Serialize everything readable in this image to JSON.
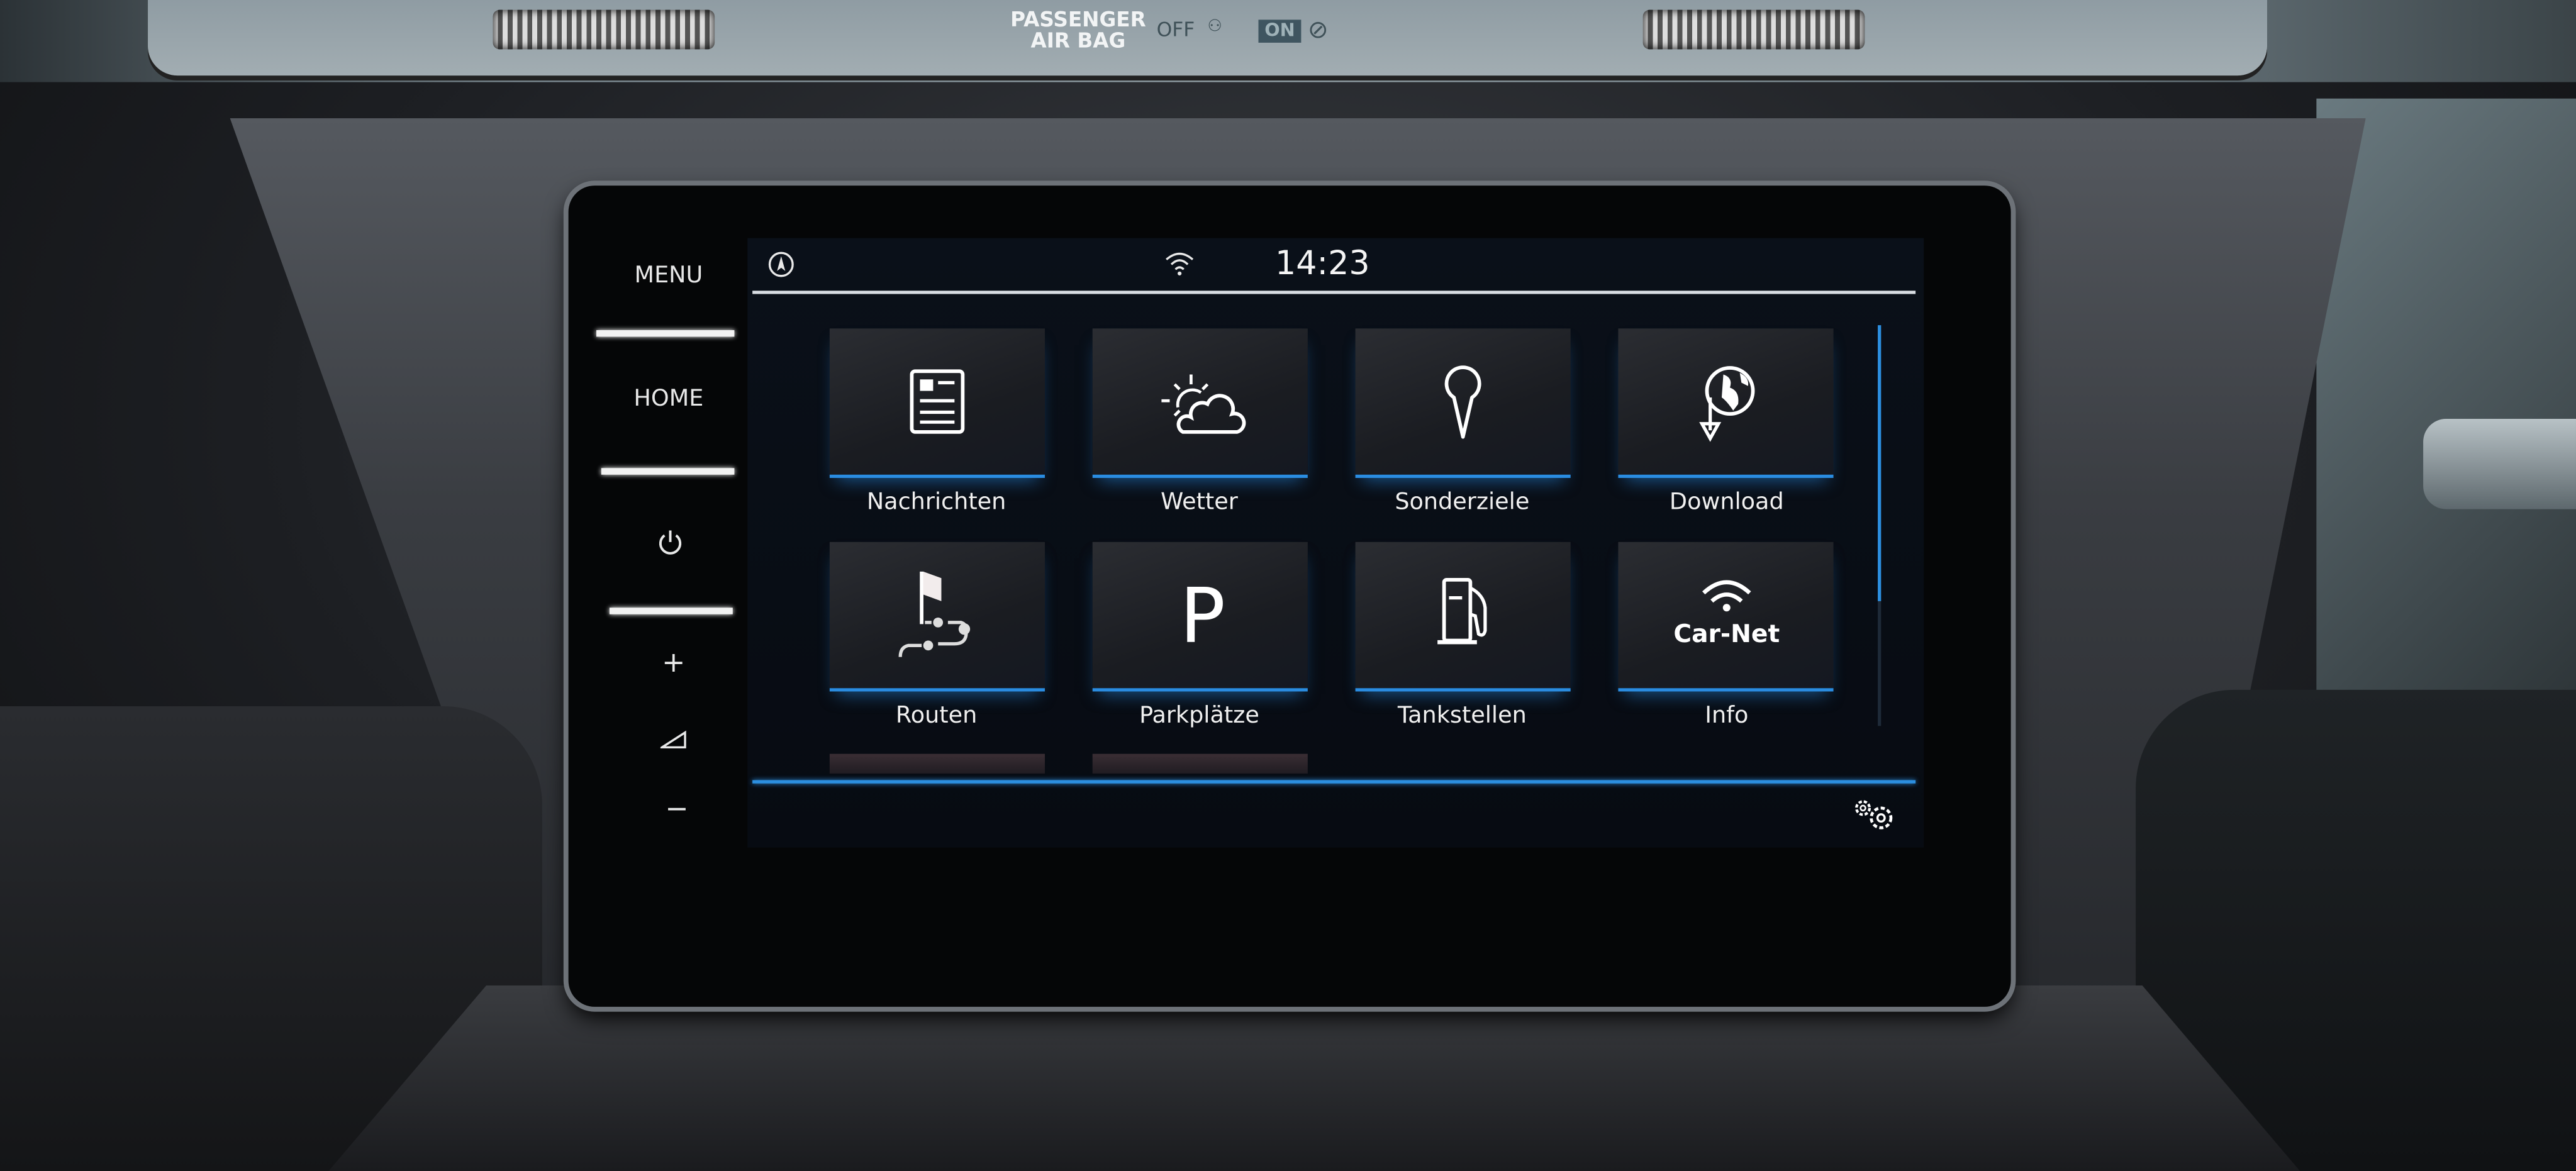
{
  "dashboard": {
    "airbag_label_line1": "PASSENGER",
    "airbag_label_line2": "AIR BAG",
    "airbag_off": "OFF",
    "airbag_on": "ON"
  },
  "hardware_buttons": {
    "menu": "MENU",
    "home": "HOME",
    "power_icon": "power-icon",
    "volume_up": "+",
    "volume_icon": "volume-icon",
    "volume_down": "−"
  },
  "status_bar": {
    "compass_icon": "compass-icon",
    "wifi_icon": "wifi-icon",
    "time": "14:23"
  },
  "tiles": [
    {
      "label": "Nachrichten",
      "icon": "news-icon"
    },
    {
      "label": "Wetter",
      "icon": "weather-icon"
    },
    {
      "label": "Sonderziele",
      "icon": "map-pin-icon"
    },
    {
      "label": "Download",
      "icon": "globe-download-icon"
    },
    {
      "label": "Routen",
      "icon": "route-flag-icon"
    },
    {
      "label": "Parkplätze",
      "icon": "parking-icon",
      "glyph": "P"
    },
    {
      "label": "Tankstellen",
      "icon": "fuel-pump-icon"
    },
    {
      "label": "Info",
      "icon": "car-net-icon",
      "glyph": "Car-Net"
    }
  ],
  "footer": {
    "settings_icon": "settings-gears-icon"
  },
  "colors": {
    "accent": "#2c8fe0",
    "screen_bg": "#0a1019",
    "tile_bg": "#1f2126"
  }
}
